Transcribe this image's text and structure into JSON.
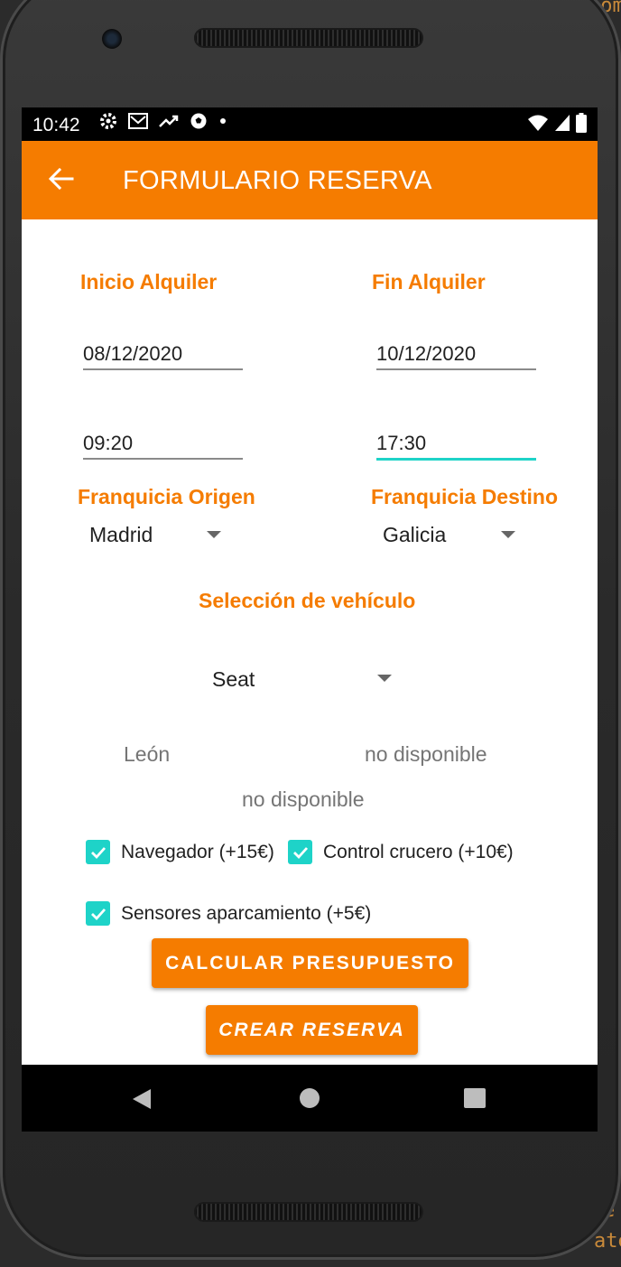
{
  "status_bar": {
    "time": "10:42",
    "icons": [
      "gear-icon",
      "gmail-icon",
      "trending-icon",
      "soccer-icon",
      "dot-icon"
    ],
    "right_icons": [
      "wifi-icon",
      "signal-icon",
      "battery-icon"
    ]
  },
  "appbar": {
    "title": "FORMULARIO RESERVA",
    "back_icon": "arrow-back-icon"
  },
  "form": {
    "start_label": "Inicio Alquiler",
    "end_label": "Fin Alquiler",
    "start_date": "08/12/2020",
    "end_date": "10/12/2020",
    "start_time": "09:20",
    "end_time": "17:30",
    "origin_label": "Franquicia Origen",
    "destination_label": "Franquicia Destino",
    "origin_value": "Madrid",
    "destination_value": "Galicia",
    "vehicle_label": "Selección de vehículo",
    "vehicle_value": "Seat",
    "model": "León",
    "availability_1": "no disponible",
    "availability_2": "no disponible"
  },
  "options": {
    "navigator": "Navegador (+15€)",
    "cruise": "Control crucero (+10€)",
    "parking": "Sensores aparcamiento (+5€)"
  },
  "buttons": {
    "calculate": "CALCULAR PRESUPUESTO",
    "create": "CREAR RESERVA"
  },
  "colors": {
    "accent": "#f57c00",
    "teal": "#1ed3c8"
  }
}
